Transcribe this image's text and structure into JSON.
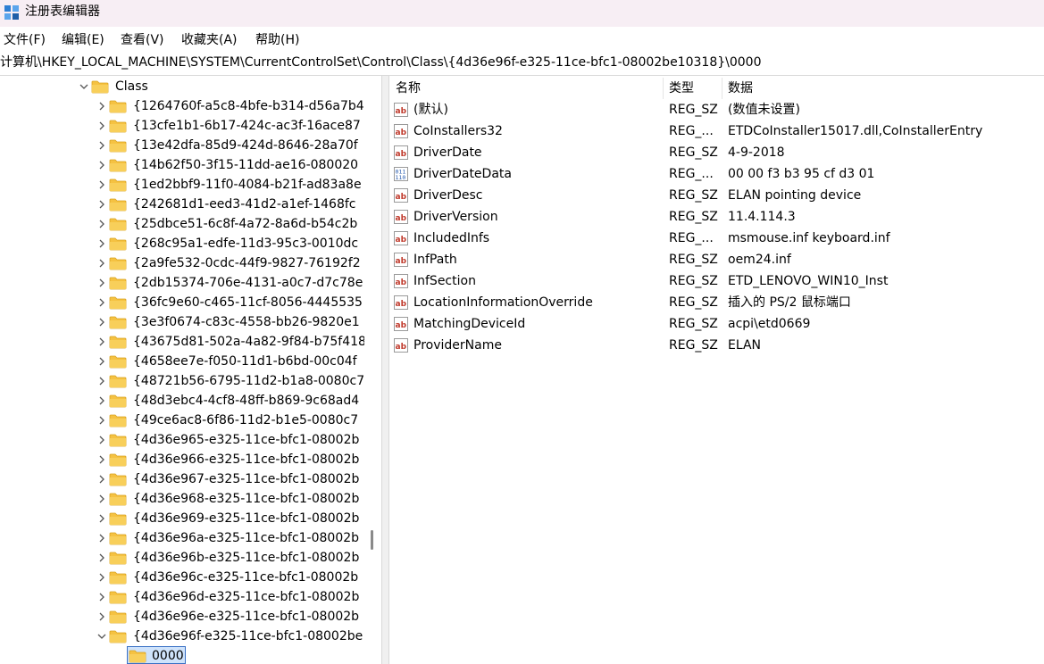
{
  "window": {
    "title": "注册表编辑器"
  },
  "menu": [
    "文件(F)",
    "编辑(E)",
    "查看(V)",
    "收藏夹(A)",
    "帮助(H)"
  ],
  "address": "计算机\\HKEY_LOCAL_MACHINE\\SYSTEM\\CurrentControlSet\\Control\\Class\\{4d36e96f-e325-11ce-bfc1-08002be10318}\\0000",
  "tree": {
    "parent": "Class",
    "items": [
      "{1264760f-a5c8-4bfe-b314-d56a7b4",
      "{13cfe1b1-6b17-424c-ac3f-16ace87",
      "{13e42dfa-85d9-424d-8646-28a70f",
      "{14b62f50-3f15-11dd-ae16-080020",
      "{1ed2bbf9-11f0-4084-b21f-ad83a8e",
      "{242681d1-eed3-41d2-a1ef-1468fc",
      "{25dbce51-6c8f-4a72-8a6d-b54c2b",
      "{268c95a1-edfe-11d3-95c3-0010dc",
      "{2a9fe532-0cdc-44f9-9827-76192f2",
      "{2db15374-706e-4131-a0c7-d7c78e",
      "{36fc9e60-c465-11cf-8056-4445535",
      "{3e3f0674-c83c-4558-bb26-9820e1",
      "{43675d81-502a-4a82-9f84-b75f418",
      "{4658ee7e-f050-11d1-b6bd-00c04f",
      "{48721b56-6795-11d2-b1a8-0080c7",
      "{48d3ebc4-4cf8-48ff-b869-9c68ad4",
      "{49ce6ac8-6f86-11d2-b1e5-0080c7",
      "{4d36e965-e325-11ce-bfc1-08002b",
      "{4d36e966-e325-11ce-bfc1-08002b",
      "{4d36e967-e325-11ce-bfc1-08002b",
      "{4d36e968-e325-11ce-bfc1-08002b",
      "{4d36e969-e325-11ce-bfc1-08002b",
      "{4d36e96a-e325-11ce-bfc1-08002b",
      "{4d36e96b-e325-11ce-bfc1-08002b",
      "{4d36e96c-e325-11ce-bfc1-08002b",
      "{4d36e96d-e325-11ce-bfc1-08002b",
      "{4d36e96e-e325-11ce-bfc1-08002b",
      "{4d36e96f-e325-11ce-bfc1-08002be"
    ],
    "selected_child": "0000"
  },
  "list": {
    "columns": [
      "名称",
      "类型",
      "数据"
    ],
    "rows": [
      {
        "name": "(默认)",
        "type": "REG_SZ",
        "data": "(数值未设置)",
        "icon": "string-value-icon"
      },
      {
        "name": "CoInstallers32",
        "type": "REG_...",
        "data": "ETDCoInstaller15017.dll,CoInstallerEntry",
        "icon": "string-value-icon"
      },
      {
        "name": "DriverDate",
        "type": "REG_SZ",
        "data": "4-9-2018",
        "icon": "string-value-icon"
      },
      {
        "name": "DriverDateData",
        "type": "REG_...",
        "data": "00 00 f3 b3 95 cf d3 01",
        "icon": "binary-value-icon"
      },
      {
        "name": "DriverDesc",
        "type": "REG_SZ",
        "data": "ELAN pointing device",
        "icon": "string-value-icon"
      },
      {
        "name": "DriverVersion",
        "type": "REG_SZ",
        "data": "11.4.114.3",
        "icon": "string-value-icon"
      },
      {
        "name": "IncludedInfs",
        "type": "REG_...",
        "data": "msmouse.inf keyboard.inf",
        "icon": "string-value-icon"
      },
      {
        "name": "InfPath",
        "type": "REG_SZ",
        "data": "oem24.inf",
        "icon": "string-value-icon"
      },
      {
        "name": "InfSection",
        "type": "REG_SZ",
        "data": "ETD_LENOVO_WIN10_Inst",
        "icon": "string-value-icon"
      },
      {
        "name": "LocationInformationOverride",
        "type": "REG_SZ",
        "data": "插入的 PS/2 鼠标端口",
        "icon": "string-value-icon"
      },
      {
        "name": "MatchingDeviceId",
        "type": "REG_SZ",
        "data": "acpi\\etd0669",
        "icon": "string-value-icon"
      },
      {
        "name": "ProviderName",
        "type": "REG_SZ",
        "data": "ELAN",
        "icon": "string-value-icon"
      }
    ]
  },
  "colors": {
    "titlebar": "#f7eef4",
    "folder": "#f5c242",
    "string_icon": "#c0392b",
    "binary_icon": "#2a5db0",
    "selection": "#cfe3fb"
  }
}
